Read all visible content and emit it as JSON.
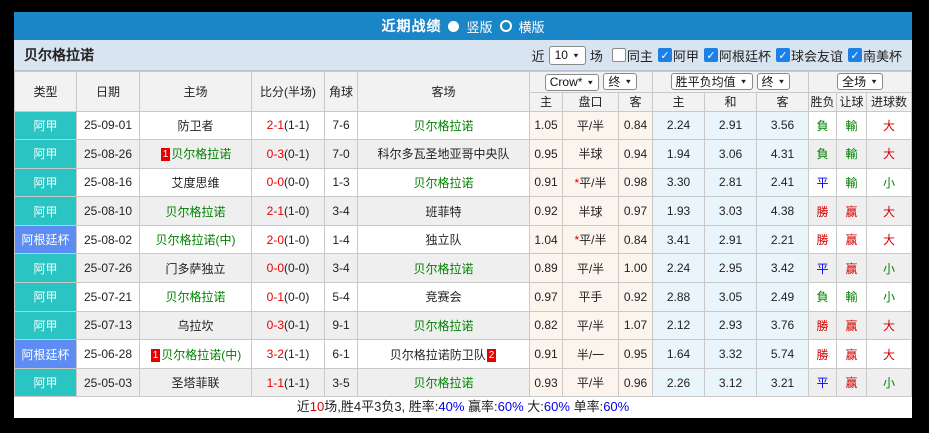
{
  "titlebar": {
    "title": "近期战绩",
    "radio_vertical": "竖版",
    "radio_horizontal": "横版"
  },
  "filterbar": {
    "team": "贝尔格拉诺",
    "near_label": "近",
    "matches_value": "10",
    "matches_label": "场",
    "checkboxes": [
      {
        "label": "同主",
        "checked": false
      },
      {
        "label": "阿甲",
        "checked": true
      },
      {
        "label": "阿根廷杯",
        "checked": true
      },
      {
        "label": "球会友谊",
        "checked": true
      },
      {
        "label": "南美杯",
        "checked": true
      }
    ]
  },
  "colors": {
    "titlebar_blue": "#1a86c8",
    "league_teal": "#2ac5c2",
    "league_blue": "#5d8df2",
    "self_team_green": "#008000",
    "score_red": "#e60000",
    "win_red": "#d40000",
    "draw_blue": "#0000f0",
    "lose_green": "#008000"
  },
  "table": {
    "header": {
      "col_type": "类型",
      "col_date": "日期",
      "col_home": "主场",
      "col_score": "比分(半场)",
      "col_corner": "角球",
      "col_away": "客场",
      "odds_select": "Crow*",
      "odds_final_select": "终",
      "avg_select": "胜平负均值",
      "avg_final_select": "终",
      "full_select": "全场",
      "sub": [
        "主",
        "盘口",
        "客",
        "主",
        "和",
        "客",
        "胜负",
        "让球",
        "进球数"
      ]
    },
    "rows": [
      {
        "league": "阿甲",
        "lc": "t-teal",
        "date": "25-09-01",
        "home": {
          "name": "防卫者",
          "self": false
        },
        "ft": "2-1",
        "ht": "(1-1)",
        "corner": "7-6",
        "away": {
          "name": "贝尔格拉诺",
          "self": true
        },
        "odds": [
          "1.05",
          "平/半",
          "0.84"
        ],
        "star": false,
        "avg": [
          "2.24",
          "2.91",
          "3.56"
        ],
        "res": [
          {
            "t": "負",
            "c": "g"
          },
          {
            "t": "輸",
            "c": "g"
          },
          {
            "t": "大",
            "c": "r"
          }
        ]
      },
      {
        "league": "阿甲",
        "lc": "t-teal",
        "date": "25-08-26",
        "home": {
          "name": "贝尔格拉诺",
          "self": true,
          "badge": "1"
        },
        "ft": "0-3",
        "ht": "(0-1)",
        "corner": "7-0",
        "away": {
          "name": "科尔多瓦圣地亚哥中央队",
          "self": false
        },
        "odds": [
          "0.95",
          "半球",
          "0.94"
        ],
        "star": false,
        "avg": [
          "1.94",
          "3.06",
          "4.31"
        ],
        "res": [
          {
            "t": "負",
            "c": "g"
          },
          {
            "t": "輸",
            "c": "g"
          },
          {
            "t": "大",
            "c": "r"
          }
        ]
      },
      {
        "league": "阿甲",
        "lc": "t-teal",
        "date": "25-08-16",
        "home": {
          "name": "艾度思维",
          "self": false
        },
        "ft": "0-0",
        "ht": "(0-0)",
        "corner": "1-3",
        "away": {
          "name": "贝尔格拉诺",
          "self": true
        },
        "odds": [
          "0.91",
          "平/半",
          "0.98"
        ],
        "star": true,
        "avg": [
          "3.30",
          "2.81",
          "2.41"
        ],
        "res": [
          {
            "t": "平",
            "c": "b"
          },
          {
            "t": "輸",
            "c": "g"
          },
          {
            "t": "小",
            "c": "g"
          }
        ]
      },
      {
        "league": "阿甲",
        "lc": "t-teal",
        "date": "25-08-10",
        "home": {
          "name": "贝尔格拉诺",
          "self": true
        },
        "ft": "2-1",
        "ht": "(1-0)",
        "corner": "3-4",
        "away": {
          "name": "班菲特",
          "self": false
        },
        "odds": [
          "0.92",
          "半球",
          "0.97"
        ],
        "star": false,
        "avg": [
          "1.93",
          "3.03",
          "4.38"
        ],
        "res": [
          {
            "t": "勝",
            "c": "r"
          },
          {
            "t": "赢",
            "c": "r"
          },
          {
            "t": "大",
            "c": "r"
          }
        ]
      },
      {
        "league": "阿根廷杯",
        "lc": "t-blue",
        "date": "25-08-02",
        "home": {
          "name": "贝尔格拉诺(中)",
          "self": true
        },
        "ft": "2-0",
        "ht": "(1-0)",
        "corner": "1-4",
        "away": {
          "name": "独立队",
          "self": false
        },
        "odds": [
          "1.04",
          "平/半",
          "0.84"
        ],
        "star": true,
        "avg": [
          "3.41",
          "2.91",
          "2.21"
        ],
        "res": [
          {
            "t": "勝",
            "c": "r"
          },
          {
            "t": "赢",
            "c": "r"
          },
          {
            "t": "大",
            "c": "r"
          }
        ]
      },
      {
        "league": "阿甲",
        "lc": "t-teal",
        "date": "25-07-26",
        "home": {
          "name": "门多萨独立",
          "self": false
        },
        "ft": "0-0",
        "ht": "(0-0)",
        "corner": "3-4",
        "away": {
          "name": "贝尔格拉诺",
          "self": true
        },
        "odds": [
          "0.89",
          "平/半",
          "1.00"
        ],
        "star": false,
        "avg": [
          "2.24",
          "2.95",
          "3.42"
        ],
        "res": [
          {
            "t": "平",
            "c": "b"
          },
          {
            "t": "赢",
            "c": "r"
          },
          {
            "t": "小",
            "c": "g"
          }
        ]
      },
      {
        "league": "阿甲",
        "lc": "t-teal",
        "date": "25-07-21",
        "home": {
          "name": "贝尔格拉诺",
          "self": true
        },
        "ft": "0-1",
        "ht": "(0-0)",
        "corner": "5-4",
        "away": {
          "name": "竞赛会",
          "self": false
        },
        "odds": [
          "0.97",
          "平手",
          "0.92"
        ],
        "star": false,
        "avg": [
          "2.88",
          "3.05",
          "2.49"
        ],
        "res": [
          {
            "t": "負",
            "c": "g"
          },
          {
            "t": "輸",
            "c": "g"
          },
          {
            "t": "小",
            "c": "g"
          }
        ]
      },
      {
        "league": "阿甲",
        "lc": "t-teal",
        "date": "25-07-13",
        "home": {
          "name": "乌拉坎",
          "self": false
        },
        "ft": "0-3",
        "ht": "(0-1)",
        "corner": "9-1",
        "away": {
          "name": "贝尔格拉诺",
          "self": true
        },
        "odds": [
          "0.82",
          "平/半",
          "1.07"
        ],
        "star": false,
        "avg": [
          "2.12",
          "2.93",
          "3.76"
        ],
        "res": [
          {
            "t": "勝",
            "c": "r"
          },
          {
            "t": "赢",
            "c": "r"
          },
          {
            "t": "大",
            "c": "r"
          }
        ]
      },
      {
        "league": "阿根廷杯",
        "lc": "t-blue",
        "date": "25-06-28",
        "home": {
          "name": "贝尔格拉诺(中)",
          "self": true,
          "badge": "1"
        },
        "ft": "3-2",
        "ht": "(1-1)",
        "corner": "6-1",
        "away": {
          "name": "贝尔格拉诺防卫队",
          "self": false,
          "badge": "2"
        },
        "odds": [
          "0.91",
          "半/一",
          "0.95"
        ],
        "star": false,
        "avg": [
          "1.64",
          "3.32",
          "5.74"
        ],
        "res": [
          {
            "t": "勝",
            "c": "r"
          },
          {
            "t": "赢",
            "c": "r"
          },
          {
            "t": "大",
            "c": "r"
          }
        ]
      },
      {
        "league": "阿甲",
        "lc": "t-teal",
        "date": "25-05-03",
        "home": {
          "name": "圣塔菲联",
          "self": false
        },
        "ft": "1-1",
        "ht": "(1-1)",
        "corner": "3-5",
        "away": {
          "name": "贝尔格拉诺",
          "self": true
        },
        "odds": [
          "0.93",
          "平/半",
          "0.96"
        ],
        "star": false,
        "avg": [
          "2.26",
          "3.12",
          "3.21"
        ],
        "res": [
          {
            "t": "平",
            "c": "b"
          },
          {
            "t": "赢",
            "c": "r"
          },
          {
            "t": "小",
            "c": "g"
          }
        ]
      }
    ]
  },
  "summary": {
    "segments": [
      {
        "t": "近",
        "c": "k"
      },
      {
        "t": "10",
        "c": "r"
      },
      {
        "t": "场,胜4平3负3, 胜率:",
        "c": "k"
      },
      {
        "t": "40%",
        "c": "b"
      },
      {
        "t": " 赢率:",
        "c": "k"
      },
      {
        "t": "60%",
        "c": "b"
      },
      {
        "t": " 大:",
        "c": "k"
      },
      {
        "t": "60%",
        "c": "b"
      },
      {
        "t": " 单率:",
        "c": "k"
      },
      {
        "t": "60%",
        "c": "b"
      }
    ]
  }
}
